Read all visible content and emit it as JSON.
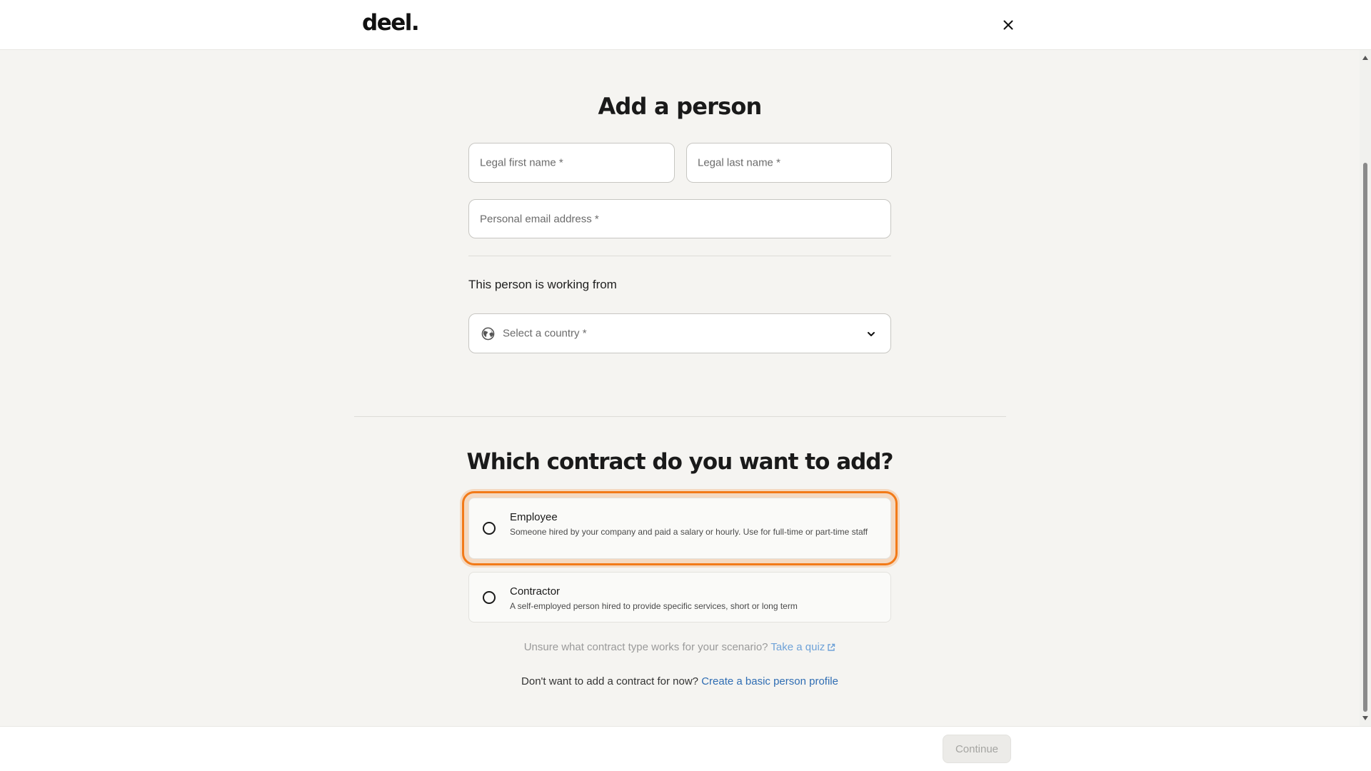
{
  "header": {
    "logo_text": "deel.",
    "close_icon": "close-icon"
  },
  "form": {
    "title": "Add a person",
    "first_name_placeholder": "Legal first name *",
    "last_name_placeholder": "Legal last name *",
    "email_placeholder": "Personal email address *",
    "working_from_label": "This person is working from",
    "country_placeholder": "Select a country *",
    "country_icon": "globe-icon",
    "dropdown_icon": "chevron-down-icon"
  },
  "contract": {
    "title": "Which contract do you want to add?",
    "options": [
      {
        "title": "Employee",
        "description": "Someone hired by your company and paid a salary or hourly. Use for full-time or part-time staff",
        "selected": false,
        "focused": true
      },
      {
        "title": "Contractor",
        "description": "A self-employed person hired to provide specific services, short or long term",
        "selected": false,
        "focused": false
      }
    ],
    "quiz_prompt": "Unsure what contract type works for your scenario?",
    "quiz_link": "Take a quiz",
    "quiz_link_icon": "external-link-icon",
    "basic_prompt": "Don't want to add a contract for now?",
    "basic_link": "Create a basic person profile"
  },
  "footer": {
    "continue_label": "Continue",
    "continue_disabled": true
  },
  "colors": {
    "focus_ring": "#f27a18",
    "link": "#2f6db3",
    "background": "#f5f4f1"
  }
}
